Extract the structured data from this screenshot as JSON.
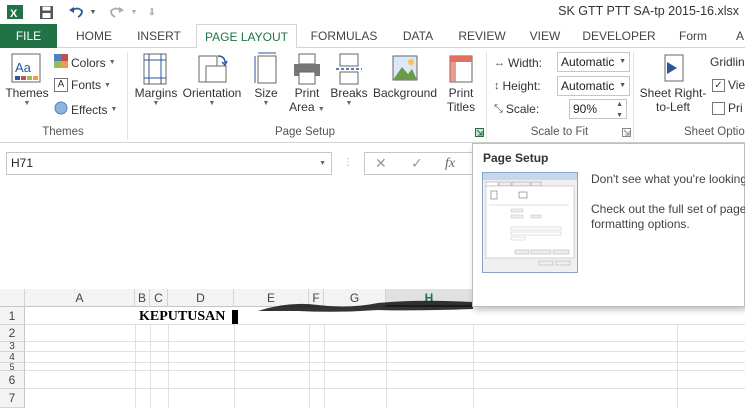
{
  "window": {
    "title": "SK GTT PTT SA-tp 2015-16.xlsx"
  },
  "tabs": {
    "file": "FILE",
    "home": "HOME",
    "insert": "INSERT",
    "page_layout": "PAGE LAYOUT",
    "formulas": "FORMULAS",
    "data": "DATA",
    "review": "REVIEW",
    "view": "VIEW",
    "developer": "DEVELOPER",
    "form": "Form",
    "more": "A"
  },
  "ribbon": {
    "themes_group": {
      "themes": "Themes",
      "colors": "Colors",
      "fonts": "Fonts",
      "effects": "Effects",
      "group_label": "Themes"
    },
    "page_setup_group": {
      "margins": "Margins",
      "orientation": "Orientation",
      "size": "Size",
      "print_area_1": "Print",
      "print_area_2": "Area",
      "breaks": "Breaks",
      "background": "Background",
      "print_titles_1": "Print",
      "print_titles_2": "Titles",
      "group_label": "Page Setup"
    },
    "scale_group": {
      "width_label": "Width:",
      "width_value": "Automatic",
      "height_label": "Height:",
      "height_value": "Automatic",
      "scale_label": "Scale:",
      "scale_value": "90%",
      "group_label": "Scale to Fit"
    },
    "sheet_options_group": {
      "sheet_rtl_1": "Sheet Right-",
      "sheet_rtl_2": "to-Left",
      "gridlines": "Gridlin",
      "view": "Vie",
      "print": "Pri",
      "group_label": "Sheet Optio"
    }
  },
  "formula_bar": {
    "name_box": "H71",
    "fx": "fx"
  },
  "tooltip": {
    "title": "Page Setup",
    "line1": "Don't see what you're looking",
    "line2": "Check out the full set of page",
    "line3": "formatting options."
  },
  "grid": {
    "columns": [
      "A",
      "B",
      "C",
      "D",
      "E",
      "F",
      "G",
      "H"
    ],
    "rows": [
      "1",
      "2",
      "3",
      "4",
      "5",
      "6",
      "7"
    ],
    "cell_A1": "KEPUTUSAN"
  },
  "colors": {
    "excel_green": "#217346"
  }
}
